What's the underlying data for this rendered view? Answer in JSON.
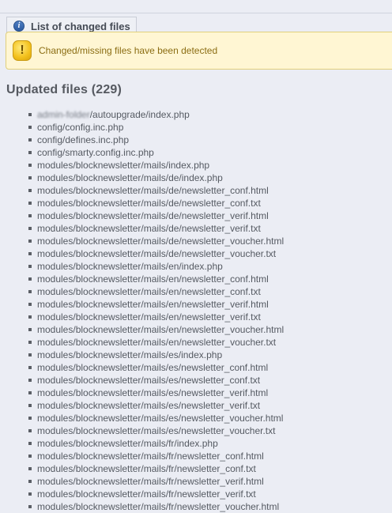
{
  "panel": {
    "title": "List of changed files",
    "icon": "info-icon"
  },
  "warning": {
    "text": "Changed/missing files have been detected",
    "icon": "warning-icon",
    "color": "#fff6d3"
  },
  "updated": {
    "heading": "Updated files (229)",
    "first_item_hidden": "admin-folder",
    "first_item_rest": "/autoupgrade/index.php",
    "files": [
      "config/config.inc.php",
      "config/defines.inc.php",
      "config/smarty.config.inc.php",
      "modules/blocknewsletter/mails/index.php",
      "modules/blocknewsletter/mails/de/index.php",
      "modules/blocknewsletter/mails/de/newsletter_conf.html",
      "modules/blocknewsletter/mails/de/newsletter_conf.txt",
      "modules/blocknewsletter/mails/de/newsletter_verif.html",
      "modules/blocknewsletter/mails/de/newsletter_verif.txt",
      "modules/blocknewsletter/mails/de/newsletter_voucher.html",
      "modules/blocknewsletter/mails/de/newsletter_voucher.txt",
      "modules/blocknewsletter/mails/en/index.php",
      "modules/blocknewsletter/mails/en/newsletter_conf.html",
      "modules/blocknewsletter/mails/en/newsletter_conf.txt",
      "modules/blocknewsletter/mails/en/newsletter_verif.html",
      "modules/blocknewsletter/mails/en/newsletter_verif.txt",
      "modules/blocknewsletter/mails/en/newsletter_voucher.html",
      "modules/blocknewsletter/mails/en/newsletter_voucher.txt",
      "modules/blocknewsletter/mails/es/index.php",
      "modules/blocknewsletter/mails/es/newsletter_conf.html",
      "modules/blocknewsletter/mails/es/newsletter_conf.txt",
      "modules/blocknewsletter/mails/es/newsletter_verif.html",
      "modules/blocknewsletter/mails/es/newsletter_verif.txt",
      "modules/blocknewsletter/mails/es/newsletter_voucher.html",
      "modules/blocknewsletter/mails/es/newsletter_voucher.txt",
      "modules/blocknewsletter/mails/fr/index.php",
      "modules/blocknewsletter/mails/fr/newsletter_conf.html",
      "modules/blocknewsletter/mails/fr/newsletter_conf.txt",
      "modules/blocknewsletter/mails/fr/newsletter_verif.html",
      "modules/blocknewsletter/mails/fr/newsletter_verif.txt",
      "modules/blocknewsletter/mails/fr/newsletter_voucher.html"
    ]
  }
}
